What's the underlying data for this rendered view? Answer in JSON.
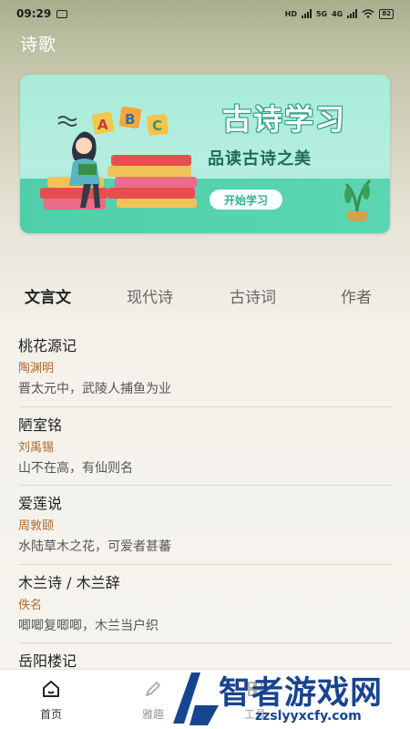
{
  "status": {
    "time": "09:29",
    "network_1": "HD",
    "network_2": "5G",
    "network_3": "4G",
    "battery": "82"
  },
  "header": {
    "title": "诗歌"
  },
  "banner": {
    "title": "古诗学习",
    "subtitle": "品读古诗之美",
    "button": "开始学习",
    "letters": [
      "A",
      "B",
      "C"
    ]
  },
  "tabs": [
    {
      "label": "文言文",
      "active": true
    },
    {
      "label": "现代诗",
      "active": false
    },
    {
      "label": "古诗词",
      "active": false
    },
    {
      "label": "作者",
      "active": false
    }
  ],
  "list": [
    {
      "title": "桃花源记",
      "author": "陶渊明",
      "line": "晋太元中，武陵人捕鱼为业"
    },
    {
      "title": "陋室铭",
      "author": "刘禹锡",
      "line": "山不在高，有仙则名"
    },
    {
      "title": "爱莲说",
      "author": "周敦颐",
      "line": "水陆草木之花，可爱者甚蕃"
    },
    {
      "title": "木兰诗 / 木兰辞",
      "author": "佚名",
      "line": "唧唧复唧唧，木兰当户织"
    },
    {
      "title": "岳阳楼记",
      "author": "",
      "line": ""
    }
  ],
  "nav": [
    {
      "label": "首页",
      "icon": "home-icon",
      "active": true
    },
    {
      "label": "雅趣",
      "icon": "pencil-icon",
      "active": false
    },
    {
      "label": "工具",
      "icon": "tools-icon",
      "active": false
    }
  ],
  "watermark": {
    "text": "智者游戏网",
    "url": "zzslyyxcfy.com"
  },
  "colors": {
    "accent": "#4fcfa9",
    "author": "#b06a30",
    "watermark": "#17448f"
  }
}
